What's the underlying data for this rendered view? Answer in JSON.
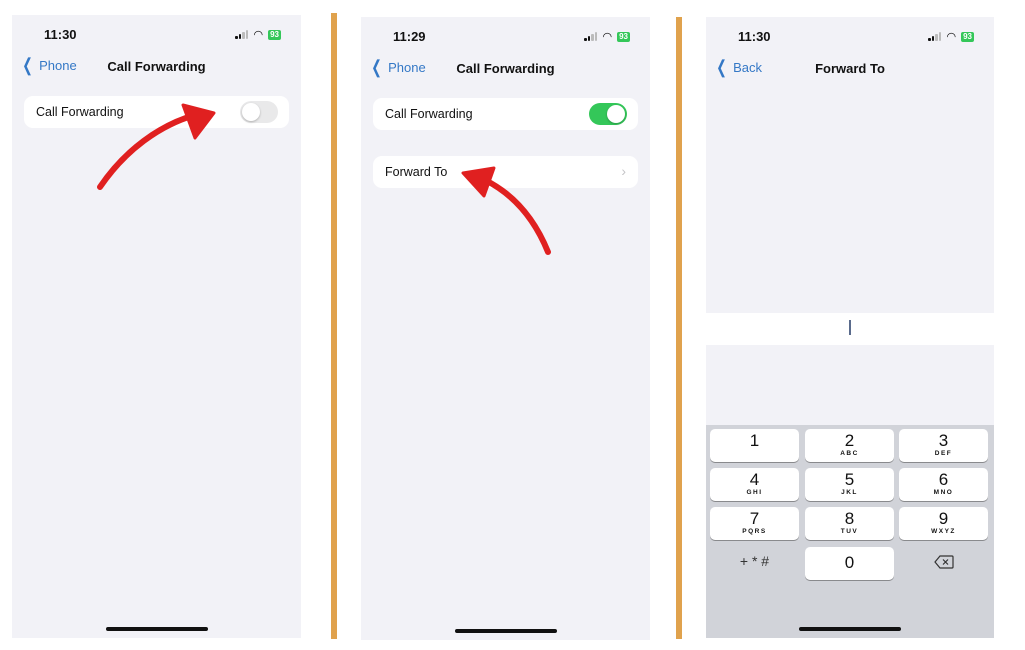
{
  "screens": [
    {
      "status": {
        "time": "11:30",
        "battery": "93"
      },
      "nav": {
        "back_label": "Phone",
        "title": "Call Forwarding"
      },
      "rows": [
        {
          "label": "Call Forwarding",
          "toggle_on": false
        }
      ]
    },
    {
      "status": {
        "time": "11:29",
        "battery": "93"
      },
      "nav": {
        "back_label": "Phone",
        "title": "Call Forwarding"
      },
      "rows": [
        {
          "label": "Call Forwarding",
          "toggle_on": true
        },
        {
          "label": "Forward To"
        }
      ]
    },
    {
      "status": {
        "time": "11:30",
        "battery": "93"
      },
      "nav": {
        "back_label": "Back",
        "title": "Forward To"
      },
      "phone_input": {
        "value": ""
      },
      "keypad": {
        "keys": [
          {
            "num": "1",
            "letters": ""
          },
          {
            "num": "2",
            "letters": "ABC"
          },
          {
            "num": "3",
            "letters": "DEF"
          },
          {
            "num": "4",
            "letters": "GHI"
          },
          {
            "num": "5",
            "letters": "JKL"
          },
          {
            "num": "6",
            "letters": "MNO"
          },
          {
            "num": "7",
            "letters": "PQRS"
          },
          {
            "num": "8",
            "letters": "TUV"
          },
          {
            "num": "9",
            "letters": "WXYZ"
          },
          {
            "num": "0",
            "letters": ""
          }
        ],
        "symbols_label": "+ * #",
        "delete_icon": "delete-backspace-icon"
      }
    }
  ],
  "annotations": {
    "arrow_color": "#e02020",
    "divider_color": "#e0a24d",
    "toggle_on_color": "#34c759"
  }
}
